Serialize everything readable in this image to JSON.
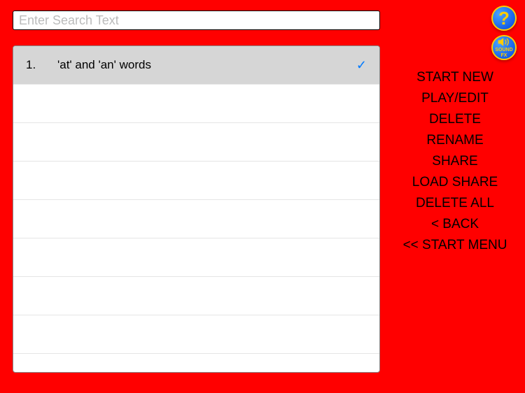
{
  "search": {
    "placeholder": "Enter Search Text"
  },
  "list": {
    "rows": [
      {
        "num": "1.",
        "title": "'at' and 'an' words",
        "selected": true
      }
    ]
  },
  "menu": {
    "items": [
      "START NEW",
      "PLAY/EDIT",
      "DELETE",
      "RENAME",
      "SHARE",
      "LOAD SHARE",
      "DELETE ALL",
      "< BACK",
      "<< START MENU"
    ]
  },
  "icons": {
    "help": "?",
    "sound_line1": "SOUND",
    "sound_line2": "FX"
  }
}
